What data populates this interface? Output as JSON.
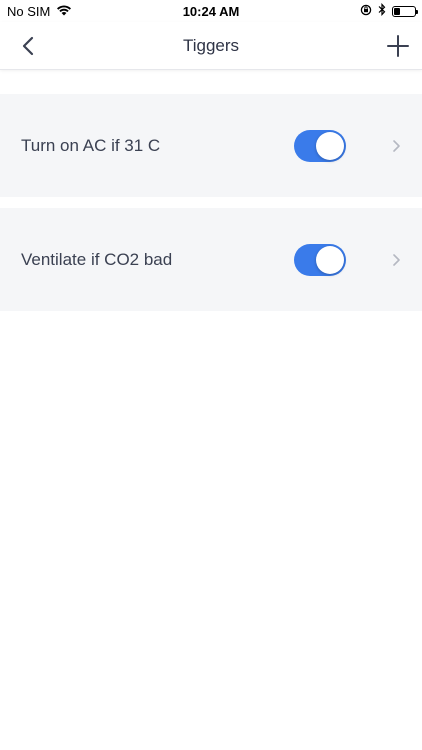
{
  "status_bar": {
    "carrier": "No SIM",
    "time": "10:24 AM",
    "battery_level": 0.3
  },
  "nav": {
    "title": "Tiggers",
    "back_icon": "chevron-left-icon",
    "add_icon": "plus-icon"
  },
  "colors": {
    "toggle_on": "#3a7bea",
    "chevron": "#b5b8c2"
  },
  "triggers": [
    {
      "label": "Turn on AC if 31 C",
      "enabled": true
    },
    {
      "label": "Ventilate if CO2 bad",
      "enabled": true
    }
  ]
}
